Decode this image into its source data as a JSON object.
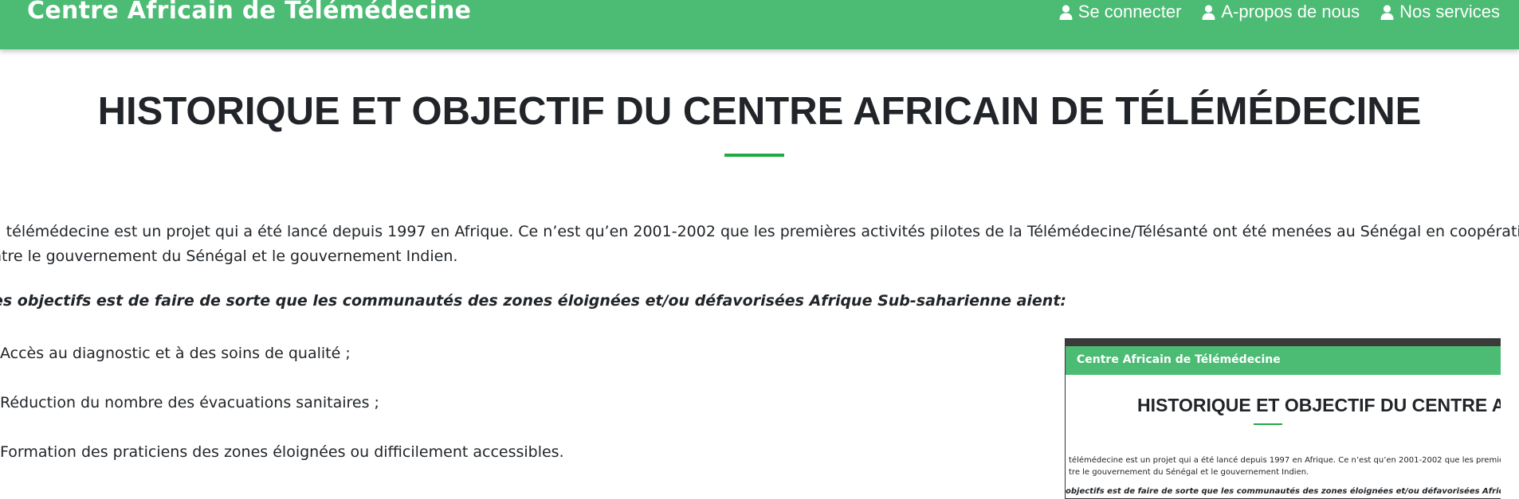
{
  "header": {
    "brand": "Centre Africain de Télémédecine",
    "nav": [
      {
        "label": "Se connecter",
        "icon": "user-icon"
      },
      {
        "label": "A-propos de nous",
        "icon": "user-icon"
      },
      {
        "label": "Nos services",
        "icon": "user-icon"
      }
    ]
  },
  "main": {
    "title": "HISTORIQUE ET OBJECTIF DU CENTRE AFRICAIN DE TÉLÉMÉDECINE",
    "intro_line1": "a télémédecine est un projet qui a été lancé depuis 1997 en Afrique. Ce n’est qu’en 2001-2002 que les premières activités pilotes de la Télémédecine/Télésanté ont été menées au Sénégal en coopération",
    "intro_line2": "ntre le gouvernement du Sénégal et le gouvernement Indien.",
    "objectives_heading": "es objectifs est de faire de sorte que les communautés des zones éloignées et/ou défavorisées Afrique Sub-saharienne aient:",
    "objectives": [
      "Accès au diagnostic et à des soins de qualité ;",
      "Réduction du nombre des évacuations sanitaires ;",
      "Formation des praticiens des zones éloignées ou difficilement accessibles."
    ]
  },
  "thumbnail": {
    "brand": "Centre Africain de Télémédecine",
    "title": "HISTORIQUE ET OBJECTIF DU CENTRE AFR",
    "intro_line1": "télémédecine est un projet qui a été lancé depuis 1997 en Afrique. Ce n’est qu’en 2001-2002 que les premières activit",
    "intro_line2": "tre le gouvernement du Sénégal et le gouvernement Indien.",
    "objectives_heading": "objectifs est de faire de sorte que les communautés des zones éloignées et/ou défavorisées Afrique Sub-saharienn"
  },
  "colors": {
    "navbar": "#4cbb74",
    "accent": "#22aa44",
    "text": "#212529"
  }
}
